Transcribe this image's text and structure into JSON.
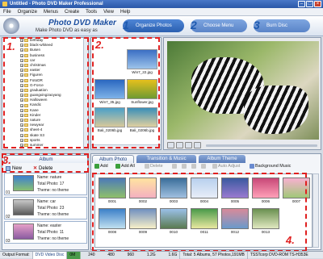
{
  "window": {
    "title": "Untitled - Photo DVD Maker Professional"
  },
  "menu": [
    "File",
    "Organize",
    "Menus",
    "Create",
    "Tools",
    "View",
    "Help"
  ],
  "brand": {
    "name": "Photo DVD Maker",
    "tagline": "Make Photo DVD as easy as"
  },
  "steps": [
    {
      "num": "1",
      "label": "Organize Photos"
    },
    {
      "num": "2",
      "label": "Choose Menu"
    },
    {
      "num": "3",
      "label": "Burn Disc"
    }
  ],
  "annotations": [
    "1.",
    "2.",
    "3.",
    "4."
  ],
  "folders": [
    "birthday",
    "black-whiteed",
    "Busen",
    "business",
    "car",
    "christmas",
    "easter",
    "Figuren",
    "FotoDR",
    "G-Force",
    "graduation",
    "guangxingzaoyang",
    "Halloween",
    "Kandic",
    "Kane",
    "Kinder",
    "nature",
    "newyear",
    "sheet-4",
    "skate S3",
    "sports",
    "summer"
  ],
  "thumbnails": [
    "Win7_22.jpg",
    "Win7_35.jpg",
    "Sunflower.jpg",
    "Bali_0206b.jpg",
    "Bali_0206b.jpg"
  ],
  "album_panel": {
    "tab": "Album",
    "new_label": "New",
    "delete_label": "Delete"
  },
  "albums": [
    {
      "num": "01",
      "name": "Name: nature",
      "photos": "Total Photo: 17",
      "theme": "Theme: no theme"
    },
    {
      "num": "02",
      "name": "Name: car",
      "photos": "Total Photo: 23",
      "theme": "Theme: no theme"
    },
    {
      "num": "03",
      "name": "Name: easter",
      "photos": "Total Photo: 11",
      "theme": "Theme: no theme"
    }
  ],
  "album_tabs": [
    "Album Photo",
    "Transition & Music",
    "Album Theme"
  ],
  "album_toolbar": [
    "Add",
    "Add All",
    "Delete",
    "Auto Adjust",
    "Background Music"
  ],
  "grid_labels": [
    "0001",
    "0002",
    "0003",
    "0004",
    "0005",
    "0006",
    "0007",
    "0008",
    "0009",
    "0010",
    "0011",
    "0012",
    "0013"
  ],
  "status": {
    "output_label": "Output Format:",
    "output_value": "DVD Video Disc",
    "scale_marks": [
      "0M",
      "240",
      "480",
      "960",
      "1.2G",
      "1.6G"
    ],
    "total": "Total: 5 Albums, 57 Photos,191MB",
    "drive": "TSSTcorp DVD-ROM TS-H353E"
  },
  "colors": {
    "accent": "#1f5bb0",
    "annotation": "#e02020"
  }
}
